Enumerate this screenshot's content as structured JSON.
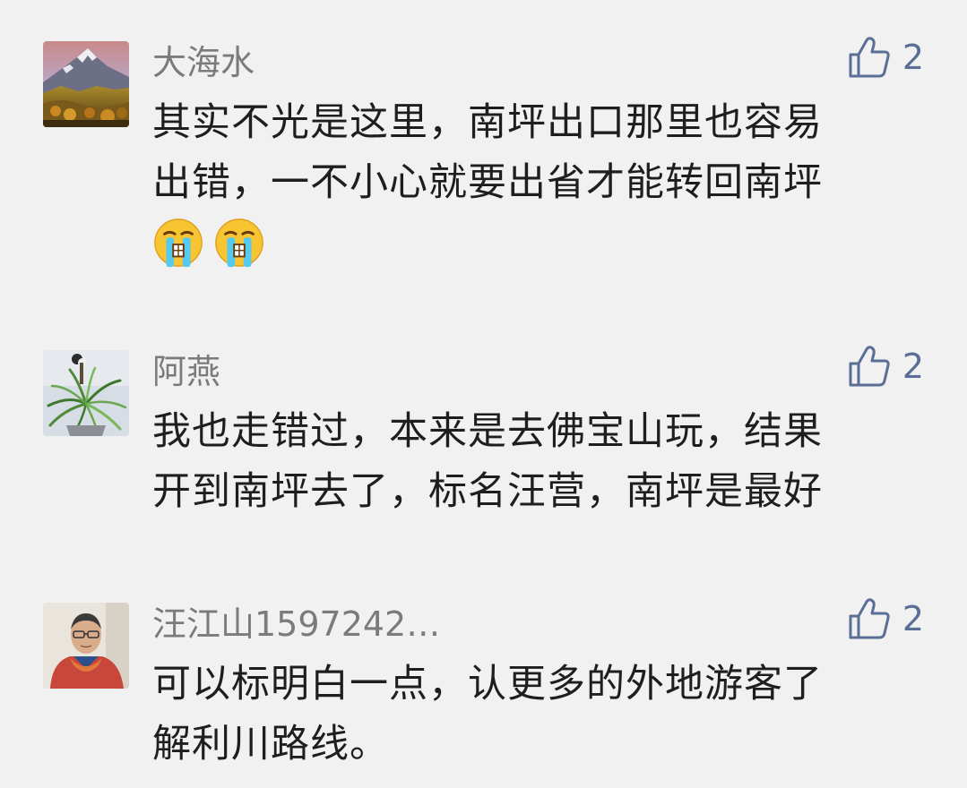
{
  "comments": [
    {
      "name": "大海水",
      "likes": "2",
      "avatar": "mountain-landscape-avatar",
      "lines": [
        "其实不光是这里，南坪出口那里也容易",
        "出错，一不小心就要出省才能转回南坪"
      ],
      "emoji": [
        "crying-face-emoji",
        "crying-face-emoji"
      ]
    },
    {
      "name": "阿燕",
      "likes": "2",
      "avatar": "spider-plant-avatar",
      "lines": [
        "我也走错过，本来是去佛宝山玩，结果",
        "开到南坪去了，标名汪营，南坪是最好"
      ]
    },
    {
      "name": "汪江山1597242…",
      "likes": "2",
      "avatar": "man-portrait-avatar",
      "lines": [
        "可以标明白一点，认更多的外地游客了",
        "解利川路线。"
      ]
    }
  ],
  "colors": {
    "background": "#f1f1f1",
    "name": "#7b7b7b",
    "like": "#5b6e95",
    "text": "#1e1e1e"
  },
  "icons": {
    "like": "thumbs-up-icon"
  }
}
